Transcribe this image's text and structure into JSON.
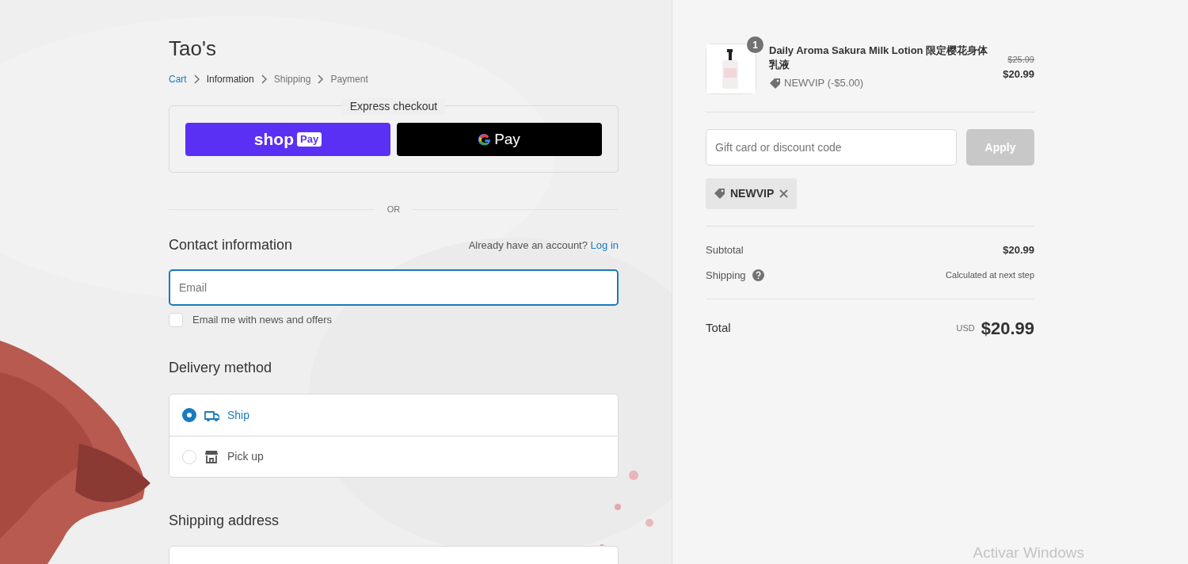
{
  "store": {
    "name": "Tao's"
  },
  "breadcrumb": [
    {
      "label": "Cart",
      "completed": true,
      "current": false
    },
    {
      "label": "Information",
      "completed": false,
      "current": true
    },
    {
      "label": "Shipping",
      "completed": false,
      "current": false
    },
    {
      "label": "Payment",
      "completed": false,
      "current": false
    }
  ],
  "express_checkout": {
    "title": "Express checkout",
    "buttons": [
      {
        "kind": "shop_pay",
        "text": "shop",
        "badge": "Pay"
      },
      {
        "kind": "google_pay",
        "text": "Pay"
      }
    ]
  },
  "divider": "OR",
  "contact": {
    "heading": "Contact information",
    "account_prompt": "Already have an account?",
    "login_link": "Log in",
    "email": {
      "placeholder": "Email",
      "focused": true
    },
    "newsletter": {
      "label": "Email me with news and offers",
      "checked": false
    }
  },
  "delivery": {
    "heading": "Delivery method",
    "options": [
      {
        "kind": "ship",
        "label": "Ship",
        "selected": true
      },
      {
        "kind": "pickup",
        "label": "Pick up",
        "selected": false
      }
    ]
  },
  "shipping_address": {
    "heading": "Shipping address"
  },
  "order": {
    "items": [
      {
        "quantity": "1",
        "name": "Daily Aroma Sakura Milk Lotion 限定樱花身体乳液",
        "discount": "NEWVIP (-$5.00)",
        "original_price": "$25.99",
        "price": "$20.99"
      }
    ],
    "discount_field": {
      "placeholder": "Gift card or discount code"
    },
    "apply_button": {
      "label": "Apply",
      "disabled": true
    },
    "applied_codes": [
      {
        "code": "NEWVIP"
      }
    ],
    "subtotal": {
      "label": "Subtotal",
      "value": "$20.99"
    },
    "shipping": {
      "label": "Shipping",
      "value": "Calculated at next step"
    },
    "total": {
      "label": "Total",
      "currency": "USD",
      "value": "$20.99"
    }
  },
  "os_overlay": {
    "text": "Activar Windows"
  }
}
